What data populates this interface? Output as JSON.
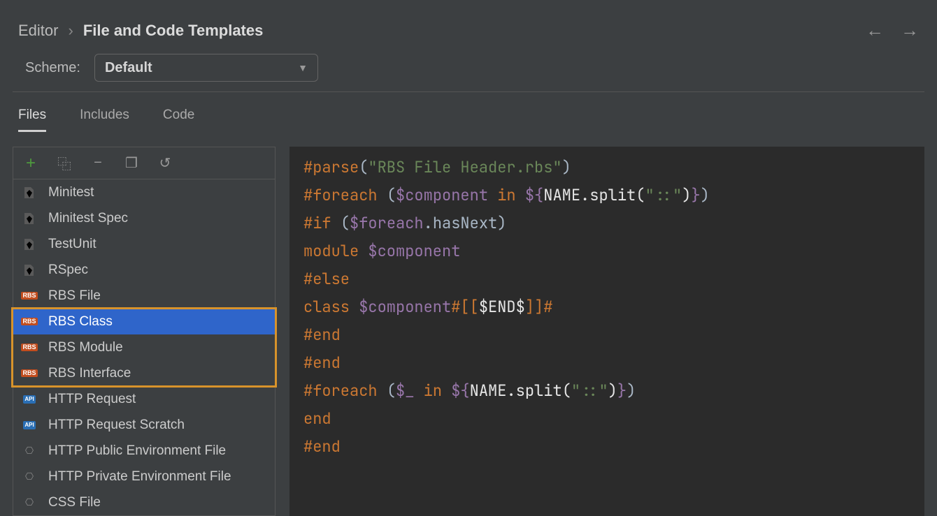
{
  "breadcrumb": {
    "parent": "Editor",
    "current": "File and Code Templates"
  },
  "scheme": {
    "label": "Scheme:",
    "value": "Default"
  },
  "tabs": [
    "Files",
    "Includes",
    "Code"
  ],
  "activeTab": 0,
  "toolbar": {
    "add": "+",
    "copy": "⿻",
    "remove": "−",
    "copyTpl": "❐",
    "revert": "↺"
  },
  "templates": [
    {
      "name": "Minitest",
      "icon": "ruby"
    },
    {
      "name": "Minitest Spec",
      "icon": "ruby"
    },
    {
      "name": "TestUnit",
      "icon": "ruby"
    },
    {
      "name": "RSpec",
      "icon": "ruby"
    },
    {
      "name": "RBS File",
      "icon": "rbs"
    },
    {
      "name": "RBS Class",
      "icon": "rbs",
      "selected": true
    },
    {
      "name": "RBS Module",
      "icon": "rbs"
    },
    {
      "name": "RBS Interface",
      "icon": "rbs"
    },
    {
      "name": "HTTP Request",
      "icon": "api"
    },
    {
      "name": "HTTP Request Scratch",
      "icon": "api"
    },
    {
      "name": "HTTP Public Environment File",
      "icon": "env"
    },
    {
      "name": "HTTP Private Environment File",
      "icon": "env"
    },
    {
      "name": "CSS File",
      "icon": "env"
    }
  ],
  "highlight": {
    "startIndex": 5,
    "endIndex": 7
  },
  "code": {
    "lines": [
      [
        {
          "t": "#parse",
          "c": "tok-dir"
        },
        {
          "t": "(",
          "c": "tok-id"
        },
        {
          "t": "\"RBS File Header.rbs\"",
          "c": "tok-str"
        },
        {
          "t": ")",
          "c": "tok-id"
        }
      ],
      [
        {
          "t": "#foreach ",
          "c": "tok-dir"
        },
        {
          "t": "(",
          "c": "tok-id"
        },
        {
          "t": "$component",
          "c": "tok-var"
        },
        {
          "t": " in ",
          "c": "tok-dir"
        },
        {
          "t": "${",
          "c": "tok-var"
        },
        {
          "t": "NAME.split(",
          "c": "tok-white"
        },
        {
          "t": "\"::\"",
          "c": "tok-str"
        },
        {
          "t": ")",
          "c": "tok-white"
        },
        {
          "t": "}",
          "c": "tok-var"
        },
        {
          "t": ")",
          "c": "tok-id"
        }
      ],
      [
        {
          "t": "#if ",
          "c": "tok-dir"
        },
        {
          "t": "(",
          "c": "tok-id"
        },
        {
          "t": "$foreach",
          "c": "tok-var"
        },
        {
          "t": ".hasNext)",
          "c": "tok-id"
        }
      ],
      [
        {
          "t": "module ",
          "c": "tok-dir"
        },
        {
          "t": "$component",
          "c": "tok-var"
        }
      ],
      [
        {
          "t": "#else",
          "c": "tok-dir"
        }
      ],
      [
        {
          "t": "class ",
          "c": "tok-dir"
        },
        {
          "t": "$component",
          "c": "tok-var"
        },
        {
          "t": "#[[",
          "c": "tok-dir"
        },
        {
          "t": "$END$",
          "c": "tok-white"
        },
        {
          "t": "]]#",
          "c": "tok-dir"
        }
      ],
      [
        {
          "t": "#end",
          "c": "tok-dir"
        }
      ],
      [
        {
          "t": "#end",
          "c": "tok-dir"
        }
      ],
      [
        {
          "t": "#foreach ",
          "c": "tok-dir"
        },
        {
          "t": "(",
          "c": "tok-id"
        },
        {
          "t": "$_",
          "c": "tok-var"
        },
        {
          "t": " in ",
          "c": "tok-dir"
        },
        {
          "t": "${",
          "c": "tok-var"
        },
        {
          "t": "NAME.split(",
          "c": "tok-white"
        },
        {
          "t": "\"::\"",
          "c": "tok-str"
        },
        {
          "t": ")",
          "c": "tok-white"
        },
        {
          "t": "}",
          "c": "tok-var"
        },
        {
          "t": ")",
          "c": "tok-id"
        }
      ],
      [
        {
          "t": "end",
          "c": "tok-dir"
        }
      ],
      [
        {
          "t": "#end",
          "c": "tok-dir"
        }
      ]
    ]
  }
}
